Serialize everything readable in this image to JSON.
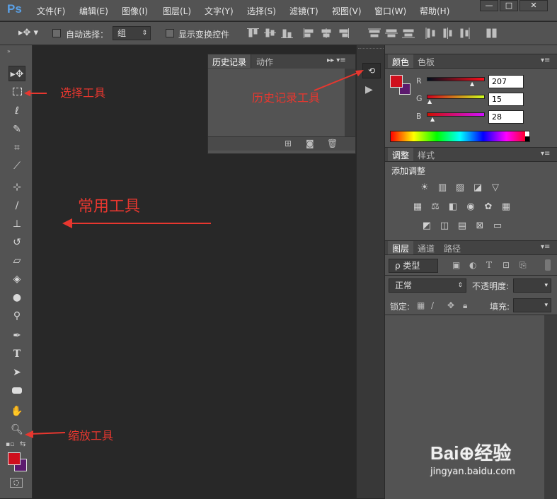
{
  "app": {
    "logo": "Ps"
  },
  "menu": {
    "items": [
      "文件(F)",
      "编辑(E)",
      "图像(I)",
      "图层(L)",
      "文字(Y)",
      "选择(S)",
      "滤镜(T)",
      "视图(V)",
      "窗口(W)",
      "帮助(H)"
    ]
  },
  "window_controls": {
    "minimize": "—",
    "restore": "□",
    "close": "✕"
  },
  "options": {
    "auto_select_label": "自动选择：",
    "auto_select_value": "组",
    "show_transform_label": "显示变换控件"
  },
  "history_panel": {
    "tabs": [
      "历史记录",
      "动作"
    ],
    "menu_glyph": "▸▸ ▾≡"
  },
  "color_panel": {
    "tabs": [
      "颜色",
      "色板"
    ],
    "channels": [
      {
        "label": "R",
        "value": "207"
      },
      {
        "label": "G",
        "value": "15"
      },
      {
        "label": "B",
        "value": "28"
      }
    ],
    "foreground": "#cf0f1c",
    "background": "#5c1a6e"
  },
  "adjust_panel": {
    "tabs": [
      "调整",
      "样式"
    ],
    "title": "添加调整"
  },
  "layers_panel": {
    "tabs": [
      "图层",
      "通道",
      "路径"
    ],
    "filter_value": "ρ 类型",
    "blend_mode": "正常",
    "opacity_label": "不透明度:",
    "lock_label": "锁定:",
    "fill_label": "填充:"
  },
  "annotations": {
    "select_tool": "选择工具",
    "history_tool": "历史记录工具",
    "common_tools": "常用工具",
    "zoom_tool": "缩放工具"
  },
  "watermark": {
    "brand": "Bai⊕经验",
    "url": "jingyan.baidu.com"
  },
  "colors": {
    "accent": "#e8372f",
    "ui_bg": "#535353",
    "canvas": "#282828"
  }
}
